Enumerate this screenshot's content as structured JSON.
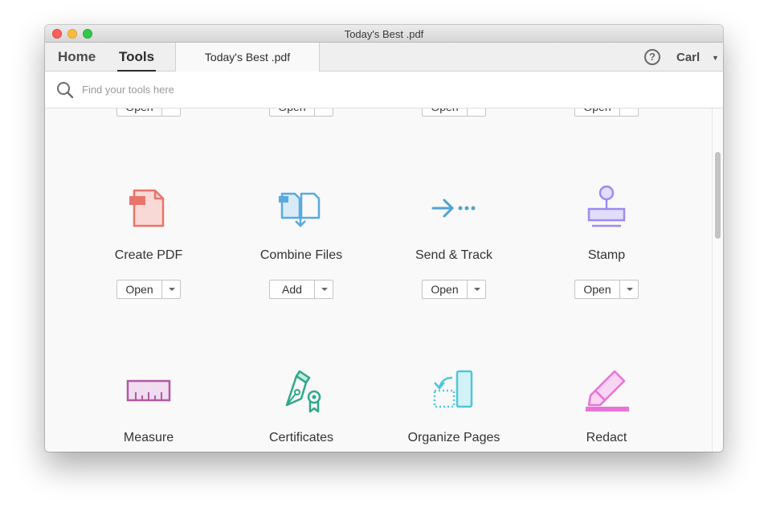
{
  "window": {
    "title": "Today's Best .pdf"
  },
  "nav": {
    "home": "Home",
    "tools": "Tools",
    "doc_tab": "Today's Best .pdf",
    "help": "?",
    "user": "Carl"
  },
  "search": {
    "placeholder": "Find your tools here"
  },
  "top_row_buttons": [
    "Open",
    "Open",
    "Open",
    "Open"
  ],
  "tools": [
    {
      "name": "Create PDF",
      "action": "Open",
      "icon": "create-pdf-icon",
      "color": "#e8746a"
    },
    {
      "name": "Combine Files",
      "action": "Add",
      "icon": "combine-files-icon",
      "color": "#5aa9df"
    },
    {
      "name": "Send & Track",
      "action": "Open",
      "icon": "send-track-icon",
      "color": "#4ea2d4"
    },
    {
      "name": "Stamp",
      "action": "Open",
      "icon": "stamp-icon",
      "color": "#9b8cf0"
    },
    {
      "name": "Measure",
      "icon": "measure-icon",
      "color": "#b05aa6"
    },
    {
      "name": "Certificates",
      "icon": "certificates-icon",
      "color": "#2fa88a"
    },
    {
      "name": "Organize Pages",
      "icon": "organize-pages-icon",
      "color": "#4fc6da"
    },
    {
      "name": "Redact",
      "icon": "redact-icon",
      "color": "#e874d8"
    }
  ]
}
